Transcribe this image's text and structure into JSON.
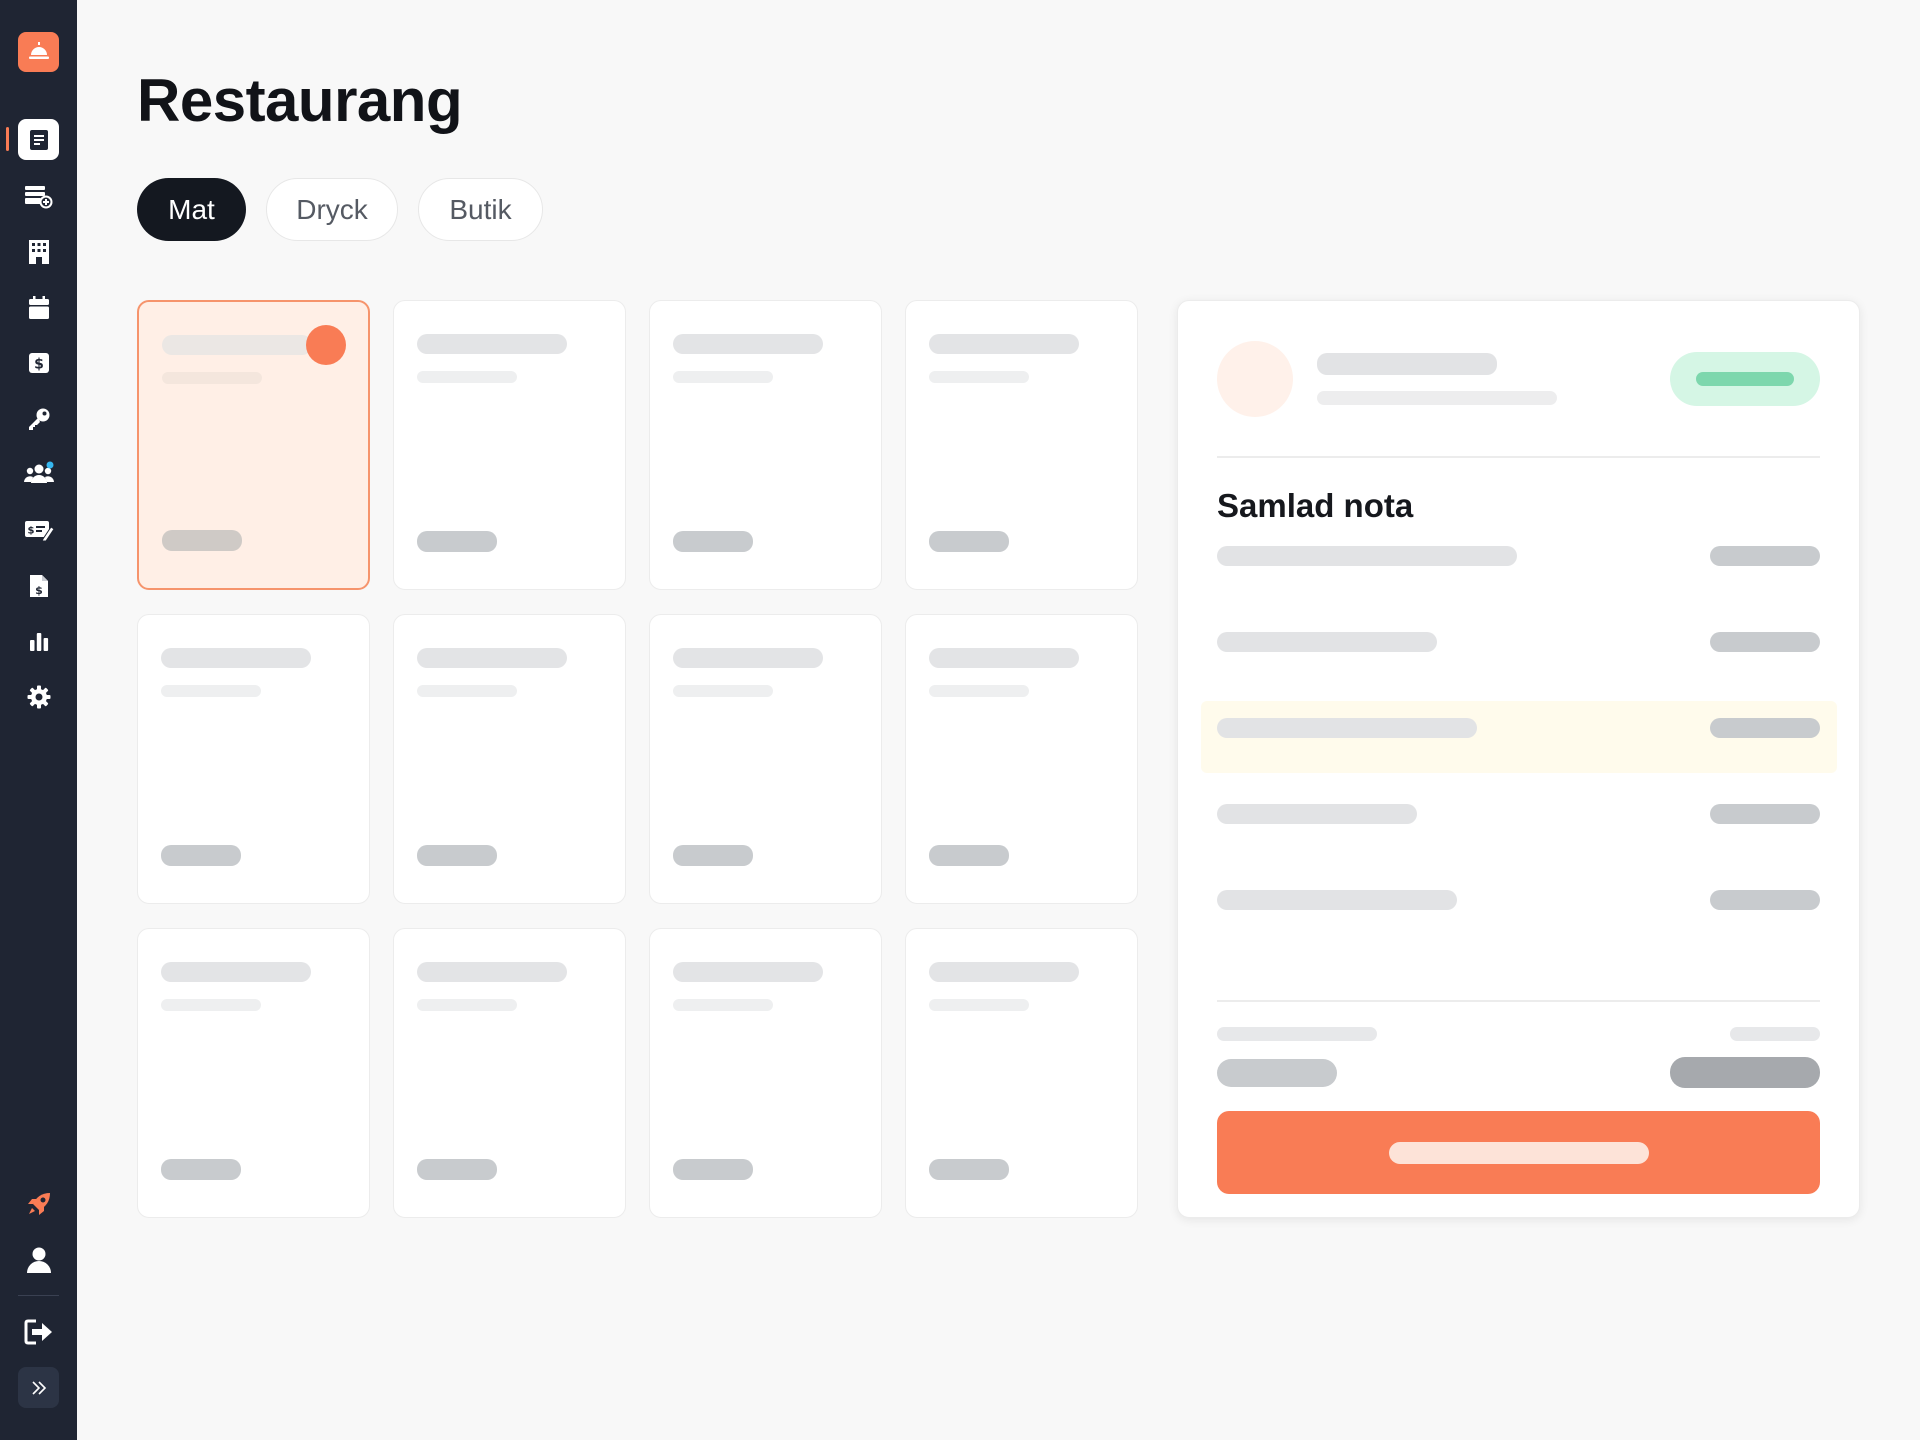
{
  "page": {
    "title": "Restaurang"
  },
  "tabs": [
    {
      "label": "Mat",
      "active": true
    },
    {
      "label": "Dryck",
      "active": false
    },
    {
      "label": "Butik",
      "active": false
    }
  ],
  "sidebar": {
    "logo_icon": "bell-icon",
    "items": [
      {
        "icon": "receipt-icon",
        "active": true
      },
      {
        "icon": "stack-add-icon",
        "active": false
      },
      {
        "icon": "building-icon",
        "active": false
      },
      {
        "icon": "calendar-icon",
        "active": false
      },
      {
        "icon": "dollar-icon",
        "active": false
      },
      {
        "icon": "key-icon",
        "active": false
      },
      {
        "icon": "users-icon",
        "active": false
      },
      {
        "icon": "price-edit-icon",
        "active": false
      },
      {
        "icon": "invoice-icon",
        "active": false
      },
      {
        "icon": "bar-chart-icon",
        "active": false
      },
      {
        "icon": "gear-icon",
        "active": false
      }
    ],
    "bottom_items": [
      {
        "icon": "rocket-icon"
      },
      {
        "icon": "user-icon"
      },
      {
        "icon": "logout-icon"
      },
      {
        "icon": "chevron-double-right-icon"
      }
    ]
  },
  "products": {
    "count": 12,
    "selected_index": 0
  },
  "summary": {
    "heading": "Samlad nota",
    "highlighted_row": 2
  },
  "colors": {
    "accent": "#f97c55",
    "sidebar": "#1f2533",
    "status": "#d5f6e5",
    "highlight": "#fffbec"
  }
}
